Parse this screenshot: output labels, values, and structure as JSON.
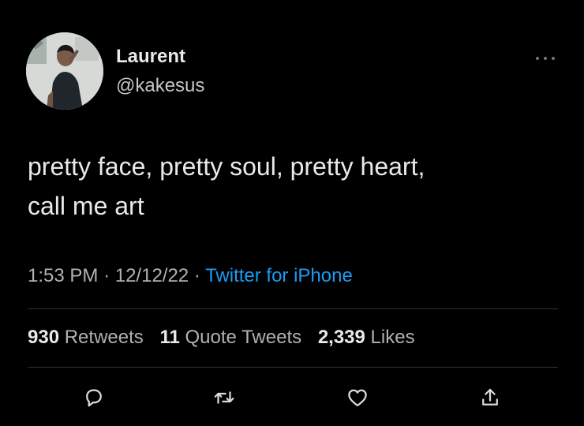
{
  "author": {
    "display_name": "Laurent",
    "handle": "@kakesus"
  },
  "tweet": {
    "text": "pretty face, pretty soul, pretty heart,\ncall me art",
    "time": "1:53 PM",
    "separator": "·",
    "date": "12/12/22",
    "source": "Twitter for iPhone"
  },
  "stats": {
    "retweets_count": "930",
    "retweets_label": "Retweets",
    "quotes_count": "11",
    "quotes_label": "Quote Tweets",
    "likes_count": "2,339",
    "likes_label": "Likes"
  },
  "icons": {
    "more": "more-horizontal-icon",
    "reply": "reply-icon",
    "retweet": "retweet-icon",
    "like": "heart-icon",
    "share": "share-icon"
  },
  "colors": {
    "background": "#000000",
    "text": "#e7e9ea",
    "secondary_text": "#aeb2b6",
    "link": "#1d9bf0",
    "divider": "#2f3336"
  }
}
